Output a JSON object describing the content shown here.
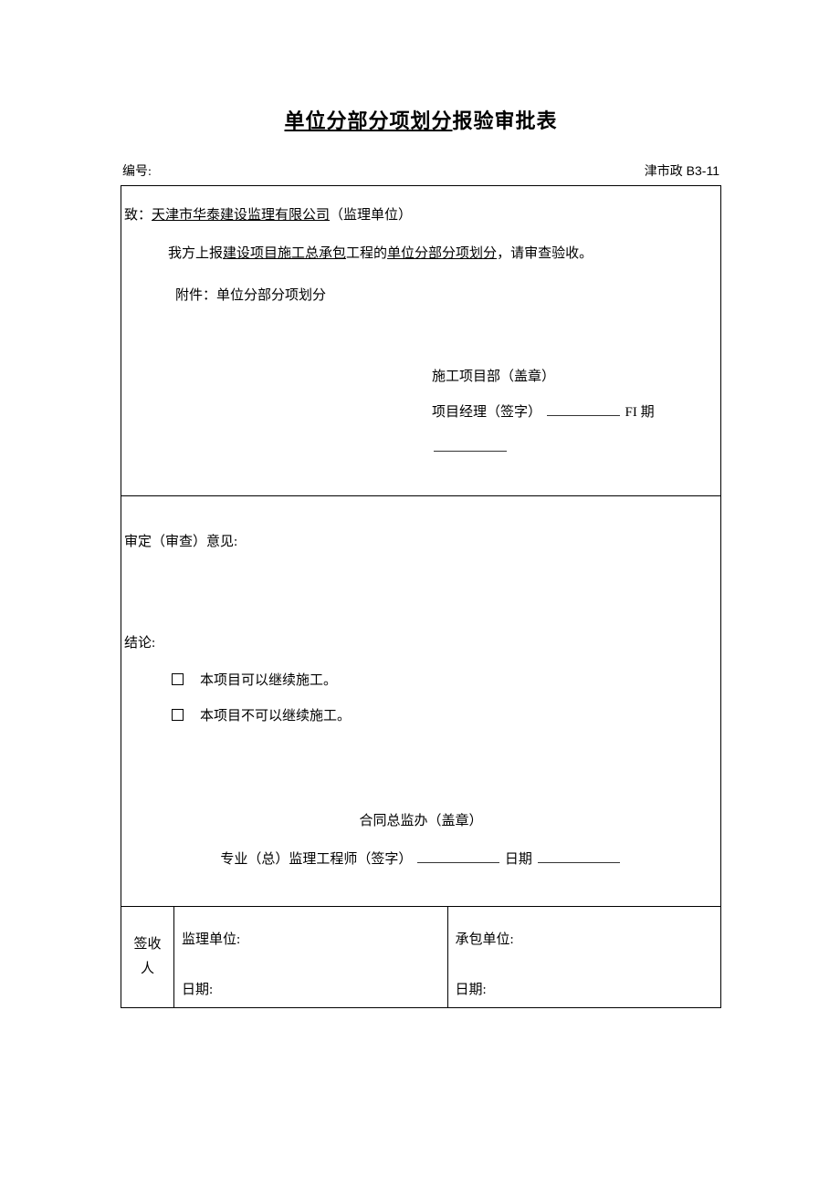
{
  "title_underlined": "单位分部分项划分",
  "title_rest": "报验审批表",
  "header": {
    "number_label": "编号:",
    "form_code": "津市政 B3-11"
  },
  "section1": {
    "to_prefix": "致：",
    "to_company": "天津市华泰建设监理有限公司",
    "to_suffix": "（监理单位）",
    "body_prefix": "我方上报",
    "body_u1": "建设项目施工总承包",
    "body_mid": "工程的",
    "body_u2": "单位分部分项划分",
    "body_suffix": "，请审查验收。",
    "attach": "附件：单位分部分项划分",
    "sig_dept": "施工项目部（盖章）",
    "sig_mgr_label": "项目经理（签字）",
    "sig_date_label": "FI 期"
  },
  "section2": {
    "review_label": "审定（审查）意见:",
    "conclusion_label": "结论:",
    "opt1": "本项目可以继续施工。",
    "opt2": "本项目不可以继续施工。",
    "sig_office": "合同总监办（盖章）",
    "sig_eng_label": "专业（总）监理工程师（签字）",
    "sig_date_label": "日期"
  },
  "section3": {
    "signer_l1": "签收",
    "signer_l2": "人",
    "supervisor_label": "监理单位:",
    "contractor_label": "承包单位:",
    "date_label": "日期:"
  }
}
